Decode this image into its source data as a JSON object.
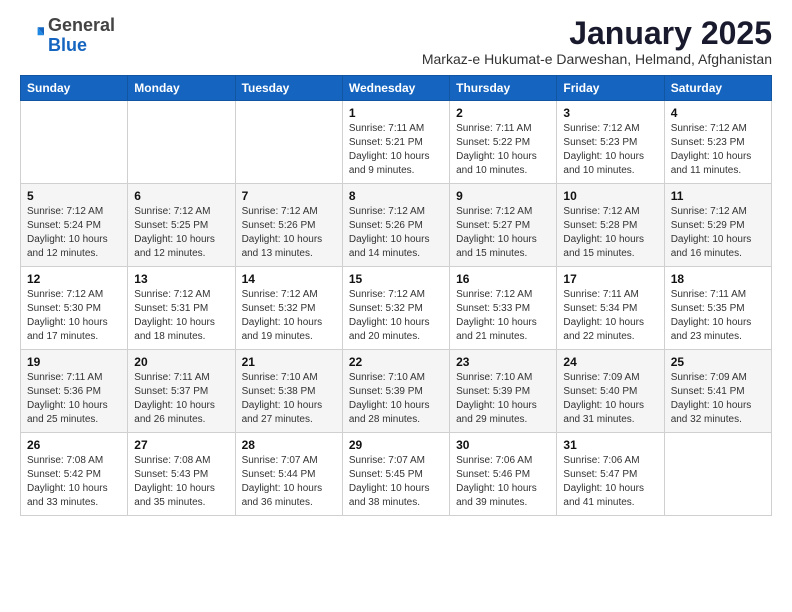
{
  "header": {
    "logo_general": "General",
    "logo_blue": "Blue",
    "month_title": "January 2025",
    "subtitle": "Markaz-e Hukumat-e Darweshan, Helmand, Afghanistan"
  },
  "weekdays": [
    "Sunday",
    "Monday",
    "Tuesday",
    "Wednesday",
    "Thursday",
    "Friday",
    "Saturday"
  ],
  "weeks": [
    [
      {
        "day": "",
        "info": ""
      },
      {
        "day": "",
        "info": ""
      },
      {
        "day": "",
        "info": ""
      },
      {
        "day": "1",
        "info": "Sunrise: 7:11 AM\nSunset: 5:21 PM\nDaylight: 10 hours\nand 9 minutes."
      },
      {
        "day": "2",
        "info": "Sunrise: 7:11 AM\nSunset: 5:22 PM\nDaylight: 10 hours\nand 10 minutes."
      },
      {
        "day": "3",
        "info": "Sunrise: 7:12 AM\nSunset: 5:23 PM\nDaylight: 10 hours\nand 10 minutes."
      },
      {
        "day": "4",
        "info": "Sunrise: 7:12 AM\nSunset: 5:23 PM\nDaylight: 10 hours\nand 11 minutes."
      }
    ],
    [
      {
        "day": "5",
        "info": "Sunrise: 7:12 AM\nSunset: 5:24 PM\nDaylight: 10 hours\nand 12 minutes."
      },
      {
        "day": "6",
        "info": "Sunrise: 7:12 AM\nSunset: 5:25 PM\nDaylight: 10 hours\nand 12 minutes."
      },
      {
        "day": "7",
        "info": "Sunrise: 7:12 AM\nSunset: 5:26 PM\nDaylight: 10 hours\nand 13 minutes."
      },
      {
        "day": "8",
        "info": "Sunrise: 7:12 AM\nSunset: 5:26 PM\nDaylight: 10 hours\nand 14 minutes."
      },
      {
        "day": "9",
        "info": "Sunrise: 7:12 AM\nSunset: 5:27 PM\nDaylight: 10 hours\nand 15 minutes."
      },
      {
        "day": "10",
        "info": "Sunrise: 7:12 AM\nSunset: 5:28 PM\nDaylight: 10 hours\nand 15 minutes."
      },
      {
        "day": "11",
        "info": "Sunrise: 7:12 AM\nSunset: 5:29 PM\nDaylight: 10 hours\nand 16 minutes."
      }
    ],
    [
      {
        "day": "12",
        "info": "Sunrise: 7:12 AM\nSunset: 5:30 PM\nDaylight: 10 hours\nand 17 minutes."
      },
      {
        "day": "13",
        "info": "Sunrise: 7:12 AM\nSunset: 5:31 PM\nDaylight: 10 hours\nand 18 minutes."
      },
      {
        "day": "14",
        "info": "Sunrise: 7:12 AM\nSunset: 5:32 PM\nDaylight: 10 hours\nand 19 minutes."
      },
      {
        "day": "15",
        "info": "Sunrise: 7:12 AM\nSunset: 5:32 PM\nDaylight: 10 hours\nand 20 minutes."
      },
      {
        "day": "16",
        "info": "Sunrise: 7:12 AM\nSunset: 5:33 PM\nDaylight: 10 hours\nand 21 minutes."
      },
      {
        "day": "17",
        "info": "Sunrise: 7:11 AM\nSunset: 5:34 PM\nDaylight: 10 hours\nand 22 minutes."
      },
      {
        "day": "18",
        "info": "Sunrise: 7:11 AM\nSunset: 5:35 PM\nDaylight: 10 hours\nand 23 minutes."
      }
    ],
    [
      {
        "day": "19",
        "info": "Sunrise: 7:11 AM\nSunset: 5:36 PM\nDaylight: 10 hours\nand 25 minutes."
      },
      {
        "day": "20",
        "info": "Sunrise: 7:11 AM\nSunset: 5:37 PM\nDaylight: 10 hours\nand 26 minutes."
      },
      {
        "day": "21",
        "info": "Sunrise: 7:10 AM\nSunset: 5:38 PM\nDaylight: 10 hours\nand 27 minutes."
      },
      {
        "day": "22",
        "info": "Sunrise: 7:10 AM\nSunset: 5:39 PM\nDaylight: 10 hours\nand 28 minutes."
      },
      {
        "day": "23",
        "info": "Sunrise: 7:10 AM\nSunset: 5:39 PM\nDaylight: 10 hours\nand 29 minutes."
      },
      {
        "day": "24",
        "info": "Sunrise: 7:09 AM\nSunset: 5:40 PM\nDaylight: 10 hours\nand 31 minutes."
      },
      {
        "day": "25",
        "info": "Sunrise: 7:09 AM\nSunset: 5:41 PM\nDaylight: 10 hours\nand 32 minutes."
      }
    ],
    [
      {
        "day": "26",
        "info": "Sunrise: 7:08 AM\nSunset: 5:42 PM\nDaylight: 10 hours\nand 33 minutes."
      },
      {
        "day": "27",
        "info": "Sunrise: 7:08 AM\nSunset: 5:43 PM\nDaylight: 10 hours\nand 35 minutes."
      },
      {
        "day": "28",
        "info": "Sunrise: 7:07 AM\nSunset: 5:44 PM\nDaylight: 10 hours\nand 36 minutes."
      },
      {
        "day": "29",
        "info": "Sunrise: 7:07 AM\nSunset: 5:45 PM\nDaylight: 10 hours\nand 38 minutes."
      },
      {
        "day": "30",
        "info": "Sunrise: 7:06 AM\nSunset: 5:46 PM\nDaylight: 10 hours\nand 39 minutes."
      },
      {
        "day": "31",
        "info": "Sunrise: 7:06 AM\nSunset: 5:47 PM\nDaylight: 10 hours\nand 41 minutes."
      },
      {
        "day": "",
        "info": ""
      }
    ]
  ]
}
